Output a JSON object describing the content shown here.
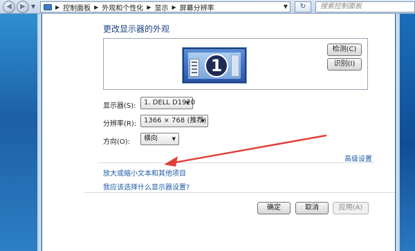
{
  "search": {
    "placeholder": "搜索控制面板"
  },
  "breadcrumb": {
    "items": [
      "控制面板",
      "外观和个性化",
      "显示",
      "屏幕分辨率"
    ]
  },
  "page": {
    "title": "更改显示器的外观"
  },
  "preview": {
    "monitor_number": "1"
  },
  "buttons": {
    "detect": "检测(C)",
    "identify": "识别(I)",
    "ok": "确定",
    "cancel": "取消",
    "apply": "应用(A)"
  },
  "fields": {
    "display": {
      "label": "显示器(S):",
      "value": "1. DELL D1920"
    },
    "resolution": {
      "label": "分辨率(R):",
      "value": "1366 × 768 (推荐)"
    },
    "orientation": {
      "label": "方向(O):",
      "value": "横向"
    }
  },
  "links": {
    "advanced": "高级设置",
    "text_size": "放大或缩小文本和其他项目",
    "which_settings": "我应该选择什么显示器设置?"
  },
  "annotation": {
    "arrow_color": "#e0403a"
  },
  "icons": [
    "back-icon",
    "forward-icon",
    "monitor-icon",
    "refresh-icon"
  ]
}
